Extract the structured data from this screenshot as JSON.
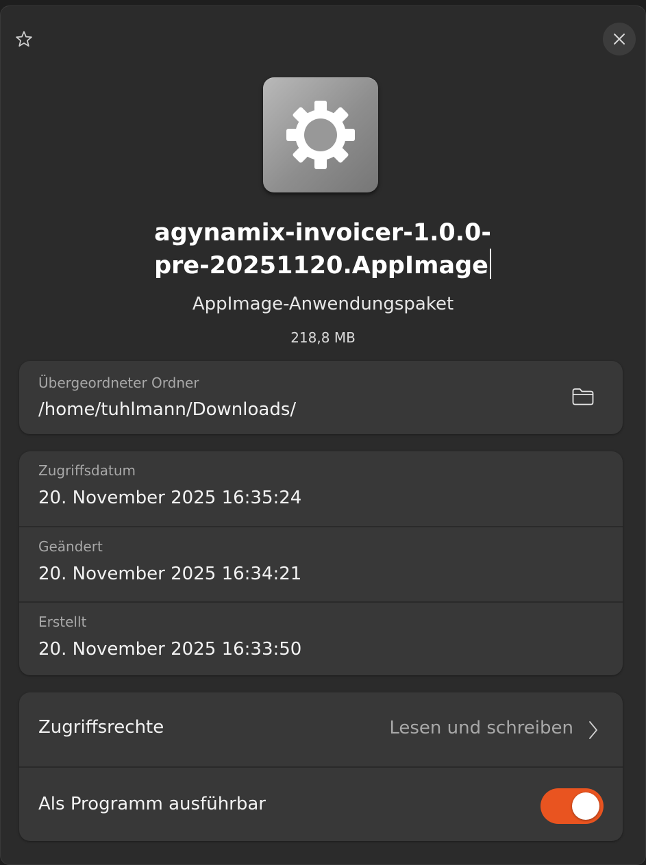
{
  "window": {
    "favorite_icon": "star-outline-icon",
    "close_icon": "close-icon"
  },
  "file": {
    "app_icon": "gear-icon",
    "name_line1": "agynamix-invoicer-1.0.0-",
    "name_line2": "pre-20251120.AppImage",
    "type": "AppImage-Anwendungspaket",
    "size": "218,8 MB"
  },
  "parent_folder": {
    "label": "Übergeordneter Ordner",
    "value": "/home/tuhlmann/Downloads/",
    "open_icon": "folder-icon"
  },
  "dates": [
    {
      "label": "Zugriffsdatum",
      "value": "20. November 2025 16:35:24"
    },
    {
      "label": "Geändert",
      "value": "20. November 2025 16:34:21"
    },
    {
      "label": "Erstellt",
      "value": "20. November 2025 16:33:50"
    }
  ],
  "permissions": {
    "label": "Zugriffsrechte",
    "value": "Lesen und schreiben",
    "chevron_icon": "chevron-right-icon"
  },
  "executable": {
    "label": "Als Programm ausführbar",
    "enabled": true
  },
  "colors": {
    "accent": "#e95420",
    "background": "#2b2b2b",
    "card": "#383838"
  }
}
